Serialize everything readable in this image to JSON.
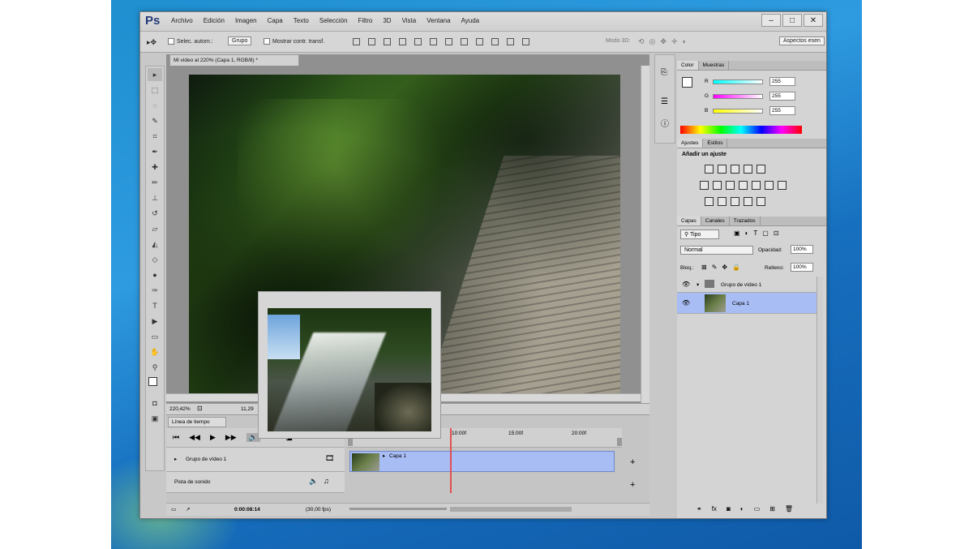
{
  "app": {
    "logo": "Ps"
  },
  "menu": [
    "Archivo",
    "Edición",
    "Imagen",
    "Capa",
    "Texto",
    "Selección",
    "Filtro",
    "3D",
    "Vista",
    "Ventana",
    "Ayuda"
  ],
  "options_bar": {
    "auto_select_label": "Selec. autom.:",
    "auto_select_value": "Grupo",
    "show_transform_label": "Mostrar contr. transf.",
    "mode_3d_label": "Modo 3D:",
    "workspace_button": "Aspectos esen"
  },
  "document": {
    "tab_title": "Mi video al 220% (Capa 1, RGB/8) *",
    "zoom": "220,42%",
    "frame_info": "11,29"
  },
  "timeline": {
    "tab": "Línea de tiempo",
    "ruler_marks": [
      "10:00f",
      "15:00f",
      "20:00f"
    ],
    "track1": "Grupo de vídeo 1",
    "track2": "Pista de sonido",
    "clip_label": "Capa 1",
    "timecode": "0:00:08:14",
    "fps": "(30,00 fps)"
  },
  "color_panel": {
    "tabs": [
      "Color",
      "Muestras"
    ],
    "labels": [
      "R",
      "G",
      "B"
    ],
    "values": [
      "255",
      "255",
      "255"
    ]
  },
  "adjustments_panel": {
    "tabs": [
      "Ajustes",
      "Estilos"
    ],
    "heading": "Añadir un ajuste"
  },
  "layers_panel": {
    "tabs": [
      "Capas",
      "Canales",
      "Trazados"
    ],
    "filter_kind": "Tipo",
    "blend_mode": "Normal",
    "opacity_label": "Opacidad:",
    "opacity_value": "100%",
    "lock_label": "Bloq.:",
    "fill_label": "Relleno:",
    "fill_value": "100%",
    "layers": [
      {
        "name": "Grupo de vídeo 1",
        "type": "group"
      },
      {
        "name": "Capa 1",
        "type": "layer",
        "selected": true
      }
    ]
  },
  "colors": {
    "accent_selected": "#a9bdf5",
    "playhead": "#e15050",
    "panel_bg": "#d4d4d4"
  }
}
